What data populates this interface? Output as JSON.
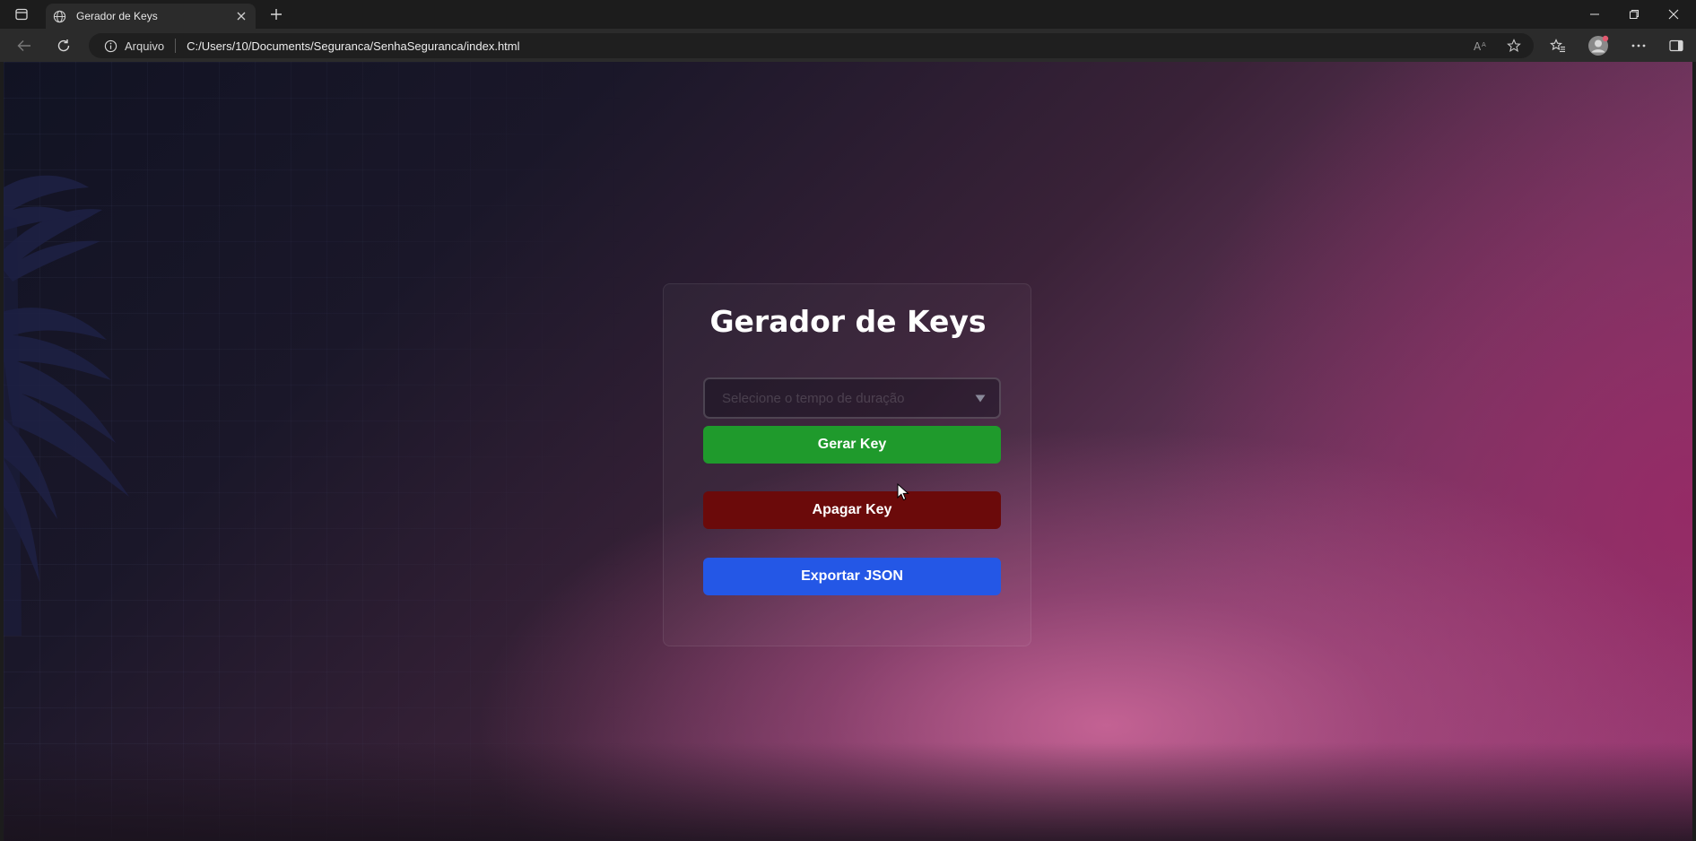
{
  "browser": {
    "tab_title": "Gerador de Keys",
    "site_label": "Arquivo",
    "url": "C:/Users/10/Documents/Seguranca/SenhaSeguranca/index.html"
  },
  "page": {
    "title": "Gerador de Keys",
    "select_placeholder": "Selecione o tempo de duração",
    "buttons": {
      "gerar": "Gerar Key",
      "apagar": "Apagar Key",
      "exportar": "Exportar JSON"
    }
  },
  "colors": {
    "gerar": "#1f9a2c",
    "apagar": "#6b0a0a",
    "exportar": "#2457e6"
  },
  "icons": [
    "tab-actions-icon",
    "globe-icon",
    "close-icon",
    "plus-icon",
    "minimize-icon",
    "restore-icon",
    "back-icon",
    "refresh-icon",
    "info-icon",
    "read-aloud-icon",
    "star-icon",
    "favorites-icon",
    "profile-icon",
    "more-icon",
    "sidebar-icon",
    "chevron-down-icon",
    "palm-tree-icon",
    "cursor-icon"
  ]
}
